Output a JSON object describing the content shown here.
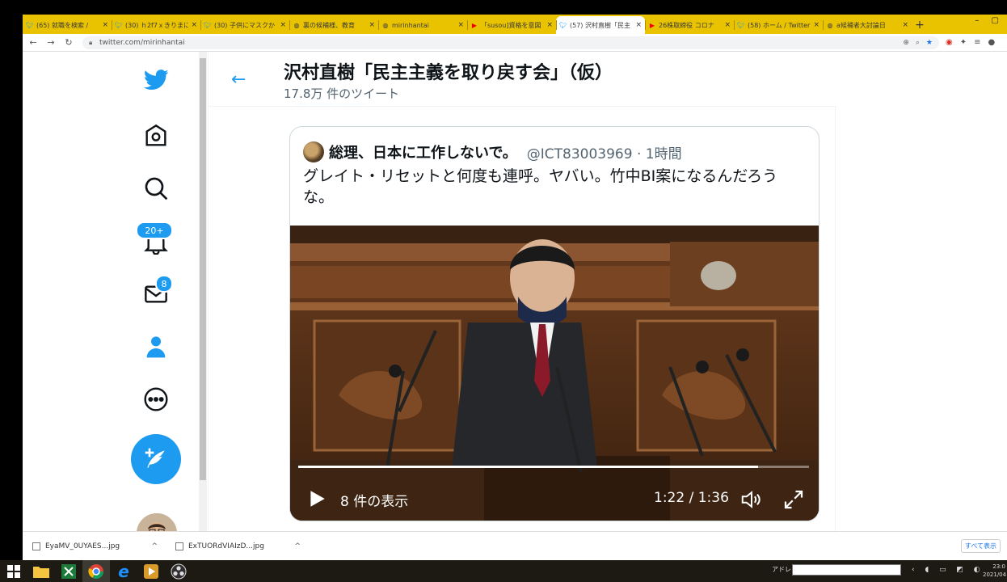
{
  "browser": {
    "tabs": [
      {
        "icon": "twitter",
        "title": "(65) 就職を検索 /"
      },
      {
        "icon": "twitter",
        "title": "(30) ｈ2f7ｘきりまに"
      },
      {
        "icon": "twitter",
        "title": "(30) 子供にマスクか"
      },
      {
        "icon": "other",
        "title": "裏の候補様、教育"
      },
      {
        "icon": "other",
        "title": "mirinhantai"
      },
      {
        "icon": "youtube",
        "title": "「susou]資格を意図"
      },
      {
        "icon": "twitter",
        "title": "(57) 沢村直樹「民主"
      },
      {
        "icon": "youtube",
        "title": "26株取締役 コロナ"
      },
      {
        "icon": "twitter",
        "title": "(58) ホーム / Twitter"
      },
      {
        "icon": "other",
        "title": "a候補者大討論日"
      }
    ],
    "url": "twitter.com/mirinhantai"
  },
  "sidebar": {
    "notifications_badge": "20+",
    "messages_badge": "8"
  },
  "profile": {
    "name": "沢村直樹「民主主義を取り戻す会」（仮）",
    "tweet_count": "17.8万 件のツイート"
  },
  "quote_tweet": {
    "author_name": "総理、日本に工作しないで。",
    "handle_time": "@ICT83003969 · 1時間",
    "text": "グレイト・リセットと何度も連呼。ヤバい。竹中BI案になるんだろうな。"
  },
  "video": {
    "views": "8 件の表示",
    "time": "1:22 / 1:36",
    "progress": 0.9
  },
  "downloads": [
    {
      "name": "EyaMV_0UYAES...jpg"
    },
    {
      "name": "ExTUORdVIAIzD...jpg"
    }
  ],
  "downloads_all": "すべて表示",
  "taskbar": {
    "address_label": "アドレス",
    "clock_time": "23:0",
    "clock_date": "2021/04"
  }
}
